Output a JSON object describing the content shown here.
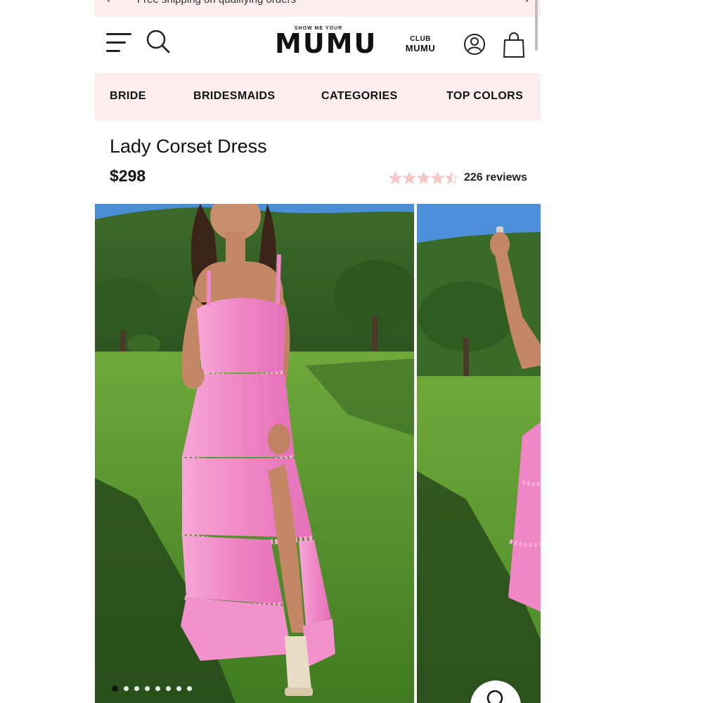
{
  "promo": {
    "text": "Free shipping on qualifying orders"
  },
  "header": {
    "logo_tag": "SHOW ME YOUR",
    "logo_main": "MUMU",
    "club_top": "CLUB",
    "club_bottom": "MUMU"
  },
  "nav": {
    "items": [
      "BRIDE",
      "BRIDESMAIDS",
      "CATEGORIES",
      "TOP COLORS"
    ]
  },
  "product": {
    "title": "Lady Corset Dress",
    "price": "$298",
    "rating": 4.5,
    "reviews_label": "226 reviews"
  },
  "gallery": {
    "image_count": 8,
    "active_index": 0
  },
  "colors": {
    "accent_pink": "#fceeee",
    "star_pink": "#f4c6c6",
    "dress_pink": "#f08ec8",
    "text": "#111111"
  },
  "icons": [
    "menu-icon",
    "search-icon",
    "account-icon",
    "cart-icon",
    "star-icon",
    "zoom-icon"
  ]
}
